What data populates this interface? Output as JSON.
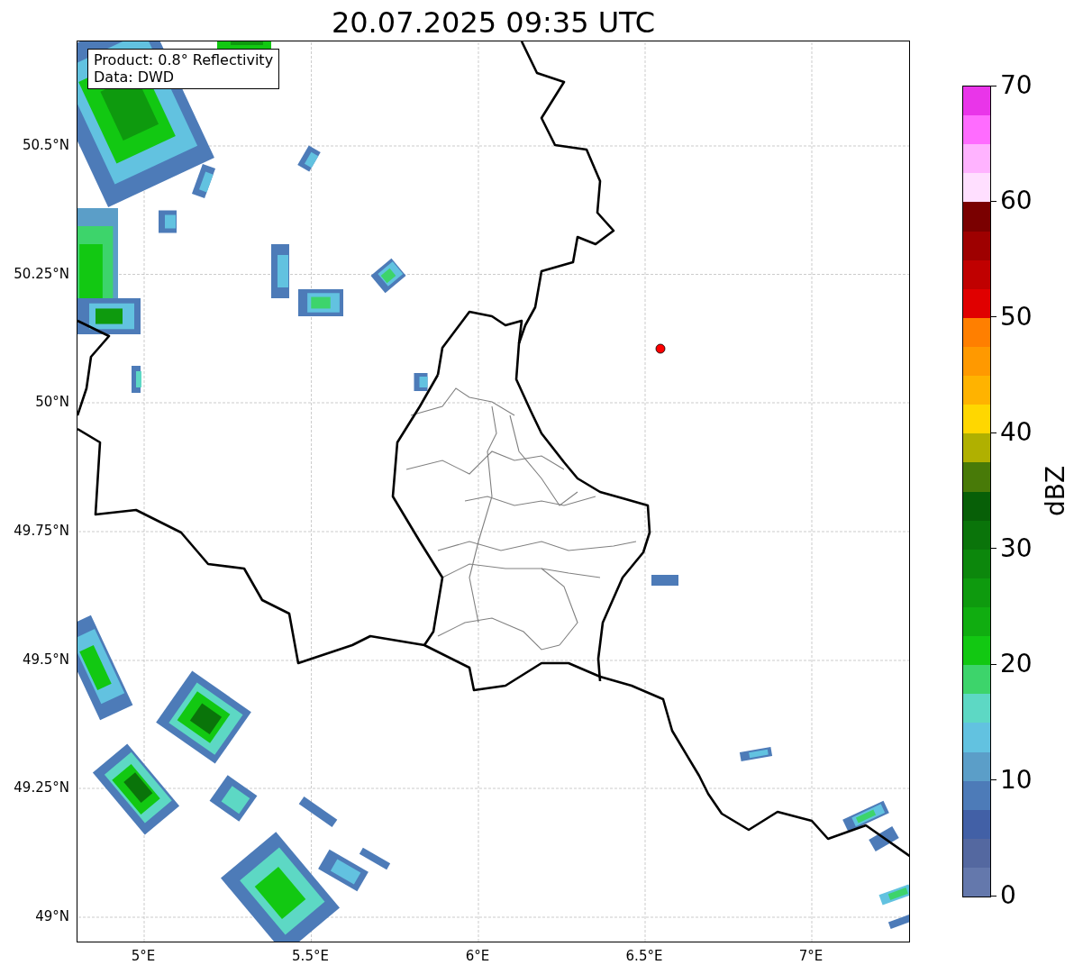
{
  "title": "20.07.2025 09:35 UTC",
  "info_box": [
    "Product: 0.8° Reflectivity",
    "Data: DWD"
  ],
  "x_ticks": [
    "5°E",
    "5.5°E",
    "6°E",
    "6.5°E",
    "7°E"
  ],
  "y_ticks": [
    "50.5°N",
    "50.25°N",
    "50°N",
    "49.75°N",
    "49.5°N",
    "49.25°N",
    "49°N"
  ],
  "colorbar": {
    "label": "dBZ",
    "ticks": [
      "70",
      "60",
      "50",
      "40",
      "30",
      "20",
      "10",
      "0"
    ],
    "segments": [
      {
        "color": "#e935e9"
      },
      {
        "color": "#ff6cff"
      },
      {
        "color": "#ffb3ff"
      },
      {
        "color": "#ffdfff"
      },
      {
        "color": "#7a0000"
      },
      {
        "color": "#9e0000"
      },
      {
        "color": "#c00000"
      },
      {
        "color": "#e00000"
      },
      {
        "color": "#ff7f00"
      },
      {
        "color": "#ff9900"
      },
      {
        "color": "#ffb300"
      },
      {
        "color": "#ffd700"
      },
      {
        "color": "#b0b000"
      },
      {
        "color": "#487a08"
      },
      {
        "color": "#075f07"
      },
      {
        "color": "#0a740a"
      },
      {
        "color": "#0c870c"
      },
      {
        "color": "#0e9a0e"
      },
      {
        "color": "#10ad10"
      },
      {
        "color": "#12c812"
      },
      {
        "color": "#3dd46b"
      },
      {
        "color": "#5dd8c4"
      },
      {
        "color": "#62c2e0"
      },
      {
        "color": "#5b9ec8"
      },
      {
        "color": "#4d7bb8"
      },
      {
        "color": "#4260a6"
      },
      {
        "color": "#5468a0"
      },
      {
        "color": "#6478ac"
      }
    ]
  }
}
